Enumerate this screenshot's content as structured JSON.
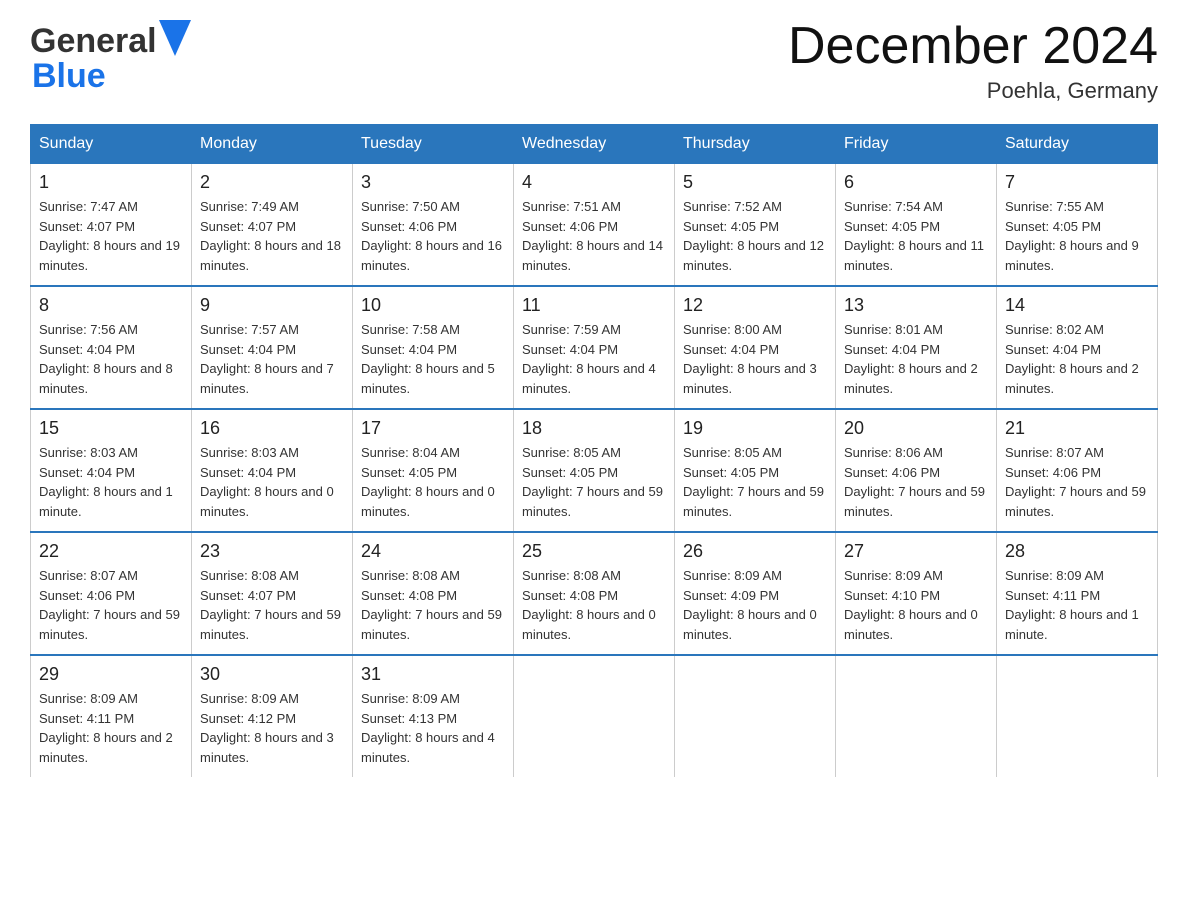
{
  "header": {
    "logo_general": "General",
    "logo_blue": "Blue",
    "month_title": "December 2024",
    "location": "Poehla, Germany"
  },
  "weekdays": [
    "Sunday",
    "Monday",
    "Tuesday",
    "Wednesday",
    "Thursday",
    "Friday",
    "Saturday"
  ],
  "weeks": [
    [
      {
        "day": "1",
        "sunrise": "7:47 AM",
        "sunset": "4:07 PM",
        "daylight": "8 hours and 19 minutes."
      },
      {
        "day": "2",
        "sunrise": "7:49 AM",
        "sunset": "4:07 PM",
        "daylight": "8 hours and 18 minutes."
      },
      {
        "day": "3",
        "sunrise": "7:50 AM",
        "sunset": "4:06 PM",
        "daylight": "8 hours and 16 minutes."
      },
      {
        "day": "4",
        "sunrise": "7:51 AM",
        "sunset": "4:06 PM",
        "daylight": "8 hours and 14 minutes."
      },
      {
        "day": "5",
        "sunrise": "7:52 AM",
        "sunset": "4:05 PM",
        "daylight": "8 hours and 12 minutes."
      },
      {
        "day": "6",
        "sunrise": "7:54 AM",
        "sunset": "4:05 PM",
        "daylight": "8 hours and 11 minutes."
      },
      {
        "day": "7",
        "sunrise": "7:55 AM",
        "sunset": "4:05 PM",
        "daylight": "8 hours and 9 minutes."
      }
    ],
    [
      {
        "day": "8",
        "sunrise": "7:56 AM",
        "sunset": "4:04 PM",
        "daylight": "8 hours and 8 minutes."
      },
      {
        "day": "9",
        "sunrise": "7:57 AM",
        "sunset": "4:04 PM",
        "daylight": "8 hours and 7 minutes."
      },
      {
        "day": "10",
        "sunrise": "7:58 AM",
        "sunset": "4:04 PM",
        "daylight": "8 hours and 5 minutes."
      },
      {
        "day": "11",
        "sunrise": "7:59 AM",
        "sunset": "4:04 PM",
        "daylight": "8 hours and 4 minutes."
      },
      {
        "day": "12",
        "sunrise": "8:00 AM",
        "sunset": "4:04 PM",
        "daylight": "8 hours and 3 minutes."
      },
      {
        "day": "13",
        "sunrise": "8:01 AM",
        "sunset": "4:04 PM",
        "daylight": "8 hours and 2 minutes."
      },
      {
        "day": "14",
        "sunrise": "8:02 AM",
        "sunset": "4:04 PM",
        "daylight": "8 hours and 2 minutes."
      }
    ],
    [
      {
        "day": "15",
        "sunrise": "8:03 AM",
        "sunset": "4:04 PM",
        "daylight": "8 hours and 1 minute."
      },
      {
        "day": "16",
        "sunrise": "8:03 AM",
        "sunset": "4:04 PM",
        "daylight": "8 hours and 0 minutes."
      },
      {
        "day": "17",
        "sunrise": "8:04 AM",
        "sunset": "4:05 PM",
        "daylight": "8 hours and 0 minutes."
      },
      {
        "day": "18",
        "sunrise": "8:05 AM",
        "sunset": "4:05 PM",
        "daylight": "7 hours and 59 minutes."
      },
      {
        "day": "19",
        "sunrise": "8:05 AM",
        "sunset": "4:05 PM",
        "daylight": "7 hours and 59 minutes."
      },
      {
        "day": "20",
        "sunrise": "8:06 AM",
        "sunset": "4:06 PM",
        "daylight": "7 hours and 59 minutes."
      },
      {
        "day": "21",
        "sunrise": "8:07 AM",
        "sunset": "4:06 PM",
        "daylight": "7 hours and 59 minutes."
      }
    ],
    [
      {
        "day": "22",
        "sunrise": "8:07 AM",
        "sunset": "4:06 PM",
        "daylight": "7 hours and 59 minutes."
      },
      {
        "day": "23",
        "sunrise": "8:08 AM",
        "sunset": "4:07 PM",
        "daylight": "7 hours and 59 minutes."
      },
      {
        "day": "24",
        "sunrise": "8:08 AM",
        "sunset": "4:08 PM",
        "daylight": "7 hours and 59 minutes."
      },
      {
        "day": "25",
        "sunrise": "8:08 AM",
        "sunset": "4:08 PM",
        "daylight": "8 hours and 0 minutes."
      },
      {
        "day": "26",
        "sunrise": "8:09 AM",
        "sunset": "4:09 PM",
        "daylight": "8 hours and 0 minutes."
      },
      {
        "day": "27",
        "sunrise": "8:09 AM",
        "sunset": "4:10 PM",
        "daylight": "8 hours and 0 minutes."
      },
      {
        "day": "28",
        "sunrise": "8:09 AM",
        "sunset": "4:11 PM",
        "daylight": "8 hours and 1 minute."
      }
    ],
    [
      {
        "day": "29",
        "sunrise": "8:09 AM",
        "sunset": "4:11 PM",
        "daylight": "8 hours and 2 minutes."
      },
      {
        "day": "30",
        "sunrise": "8:09 AM",
        "sunset": "4:12 PM",
        "daylight": "8 hours and 3 minutes."
      },
      {
        "day": "31",
        "sunrise": "8:09 AM",
        "sunset": "4:13 PM",
        "daylight": "8 hours and 4 minutes."
      },
      null,
      null,
      null,
      null
    ]
  ],
  "labels": {
    "sunrise": "Sunrise:",
    "sunset": "Sunset:",
    "daylight": "Daylight:"
  }
}
